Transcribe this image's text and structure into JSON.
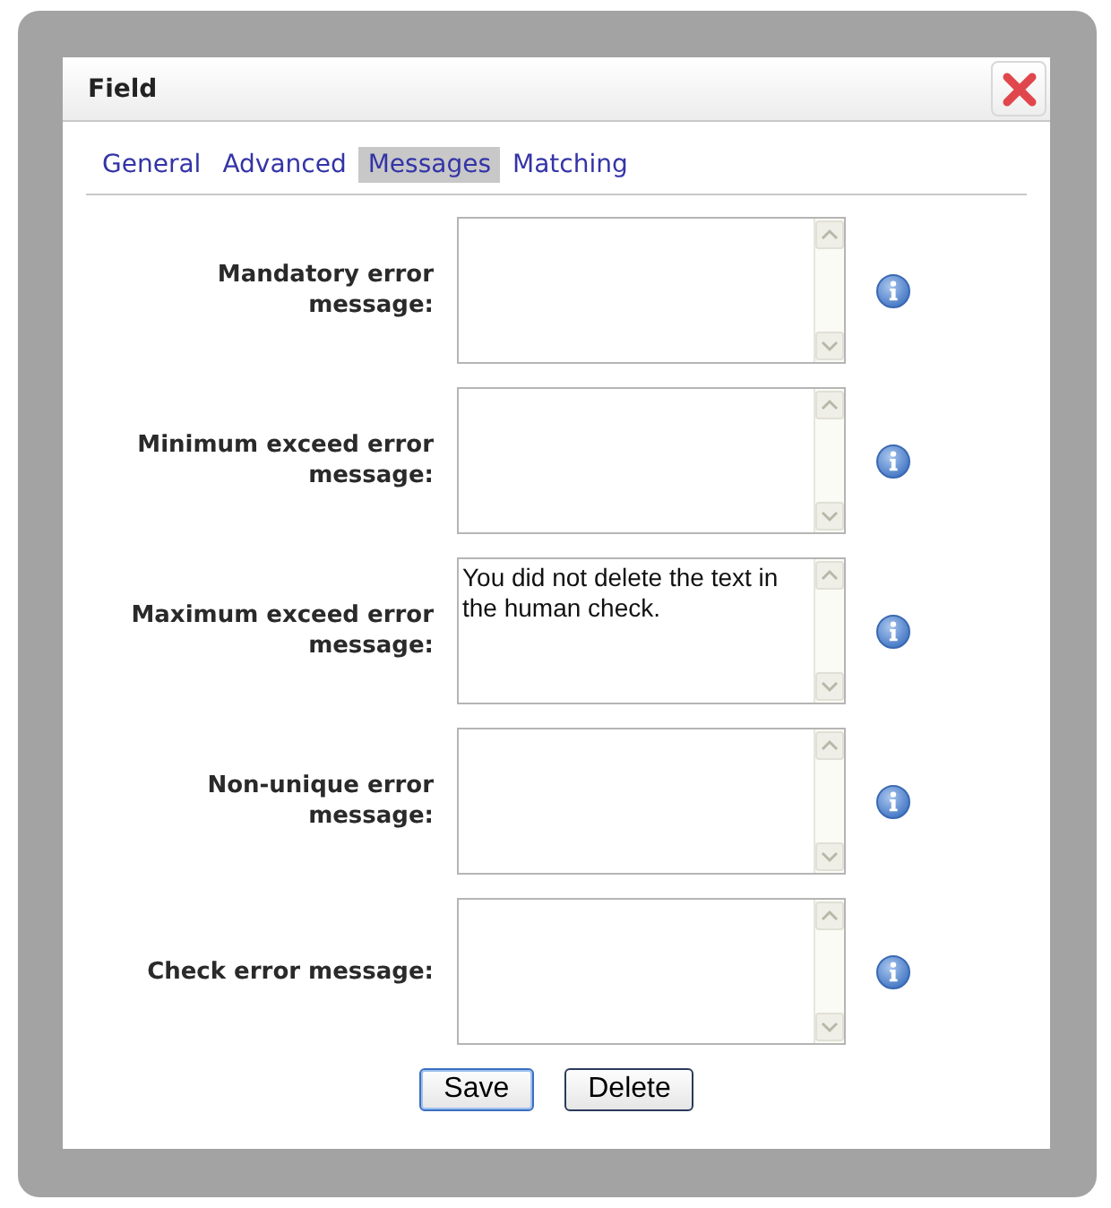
{
  "dialog": {
    "title": "Field",
    "tabs": [
      {
        "label": "General",
        "selected": false
      },
      {
        "label": "Advanced",
        "selected": false
      },
      {
        "label": "Messages",
        "selected": true
      },
      {
        "label": "Matching",
        "selected": false
      }
    ],
    "fields": [
      {
        "label": "Mandatory error message:"
      },
      {
        "label": "Minimum exceed error message:"
      },
      {
        "label": "Maximum exceed error message:",
        "value": "You did not delete the text in the human check."
      },
      {
        "label": "Non-unique error message:"
      },
      {
        "label": "Check error message:"
      }
    ],
    "buttons": [
      {
        "label": "Save",
        "kind": "default"
      },
      {
        "label": "Delete",
        "kind": "normal"
      }
    ]
  }
}
